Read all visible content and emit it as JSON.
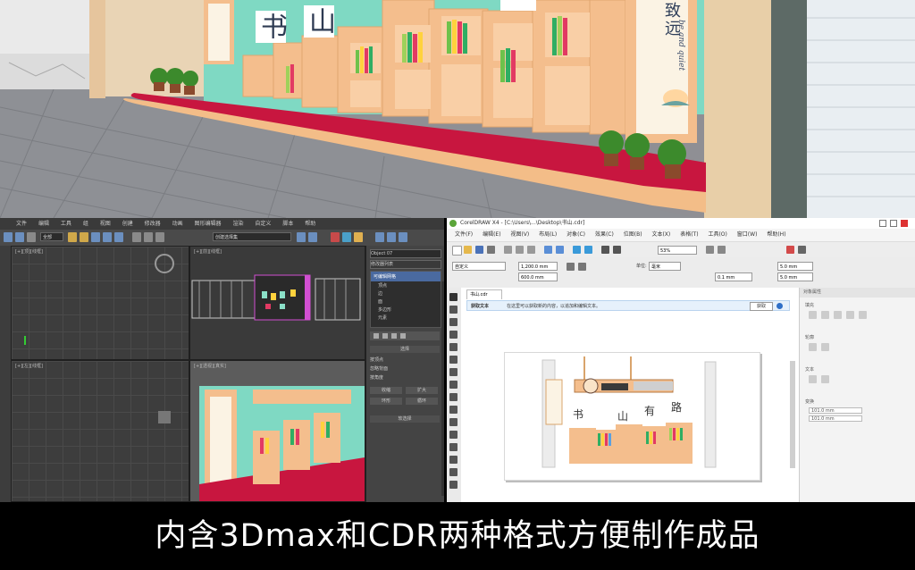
{
  "render": {
    "sign_chars": [
      "书",
      "山"
    ],
    "banner_right": "致远",
    "banner_script": "be and quiet",
    "colors": {
      "floor": "#9a9ca1",
      "platform": "#c8163f",
      "wood": "#f4be8d",
      "mint": "#7fd9c3",
      "wall": "#e7d1b2"
    }
  },
  "max": {
    "menu": [
      "文件",
      "编辑",
      "工具",
      "组",
      "视图",
      "创建",
      "修改器",
      "动画",
      "图形编辑器",
      "渲染",
      "自定义",
      "脚本",
      "帮助"
    ],
    "toolbar_field_1": "全部",
    "toolbar_field_2": "创建选择集",
    "viewports": [
      {
        "label": "[+][顶][线框]"
      },
      {
        "label": "[+][前][线框]"
      },
      {
        "label": "[+][左][线框]"
      },
      {
        "label": "[+][透视][真实]"
      }
    ],
    "cmd_panel": {
      "field": "Object 07",
      "list_title": "修改器列表",
      "items": [
        "可编辑网格",
        "顶点",
        "边",
        "面",
        "多边形",
        "元素"
      ],
      "section": "选择",
      "options": [
        "按顶点",
        "忽略背面",
        "按角度",
        "收缩",
        "扩大",
        "环形",
        "循环"
      ],
      "section_2": "软选择"
    }
  },
  "cdr": {
    "title": "CorelDRAW X4 - [C:\\Users\\...\\Desktop\\书山.cdr]",
    "menu": [
      "文件(F)",
      "编辑(E)",
      "视图(V)",
      "布局(L)",
      "对象(C)",
      "效果(C)",
      "位图(B)",
      "文本(X)",
      "表格(T)",
      "工具(O)",
      "窗口(W)",
      "帮助(H)"
    ],
    "zoom": "53%",
    "unit_label": "单位:",
    "unit_value": "毫米",
    "preset": "自定义",
    "width_field": "1,200.0 mm",
    "height_field": "600.0 mm",
    "nudge": "0.1 mm",
    "dup_x": "5.0 mm",
    "dup_y": "5.0 mm",
    "doc_tab": "书山.cdr",
    "notice_left": "获取文本",
    "notice_text": "在这里可以获取新的内容，以追加和编辑文本。",
    "notice_button": "获取",
    "dock_title": "对象属性",
    "dock_items": [
      "填充",
      "轮廓",
      "文本",
      "变换"
    ],
    "dock_values": [
      "101.0 mm",
      "101.0 mm"
    ],
    "art_chars": [
      "书",
      "山",
      "有",
      "路"
    ]
  },
  "caption": "内含3Dmax和CDR两种格式方便制作成品"
}
